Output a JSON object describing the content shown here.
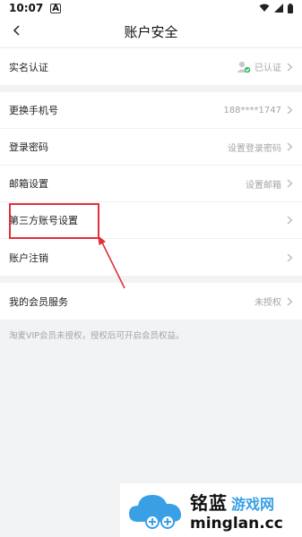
{
  "status_bar": {
    "time": "10:07",
    "app_icon": "A"
  },
  "header": {
    "title": "账户安全",
    "back_icon": "chevron-left-icon"
  },
  "rows": {
    "realname": {
      "label": "实名认证",
      "value": "已认证"
    },
    "phone": {
      "label": "更换手机号",
      "value": "188****1747"
    },
    "password": {
      "label": "登录密码",
      "value": "设置登录密码"
    },
    "email": {
      "label": "邮箱设置",
      "value": "设置邮箱"
    },
    "third_party": {
      "label": "第三方账号设置"
    },
    "cancel": {
      "label": "账户注销"
    },
    "vip": {
      "label": "我的会员服务",
      "value": "未授权"
    }
  },
  "note": "淘麦VIP会员未授权，授权后可开启会员权益。",
  "annotation": {
    "box_color": "#e0303a"
  },
  "watermark": {
    "brand": "铭蓝",
    "sub": "游戏网",
    "url": "minglan.cc"
  },
  "colors": {
    "background": "#f2f3f5",
    "muted_text": "#a4a4a4",
    "accent_blue": "#3aa0e6",
    "verified_green": "#3bbf6b"
  }
}
